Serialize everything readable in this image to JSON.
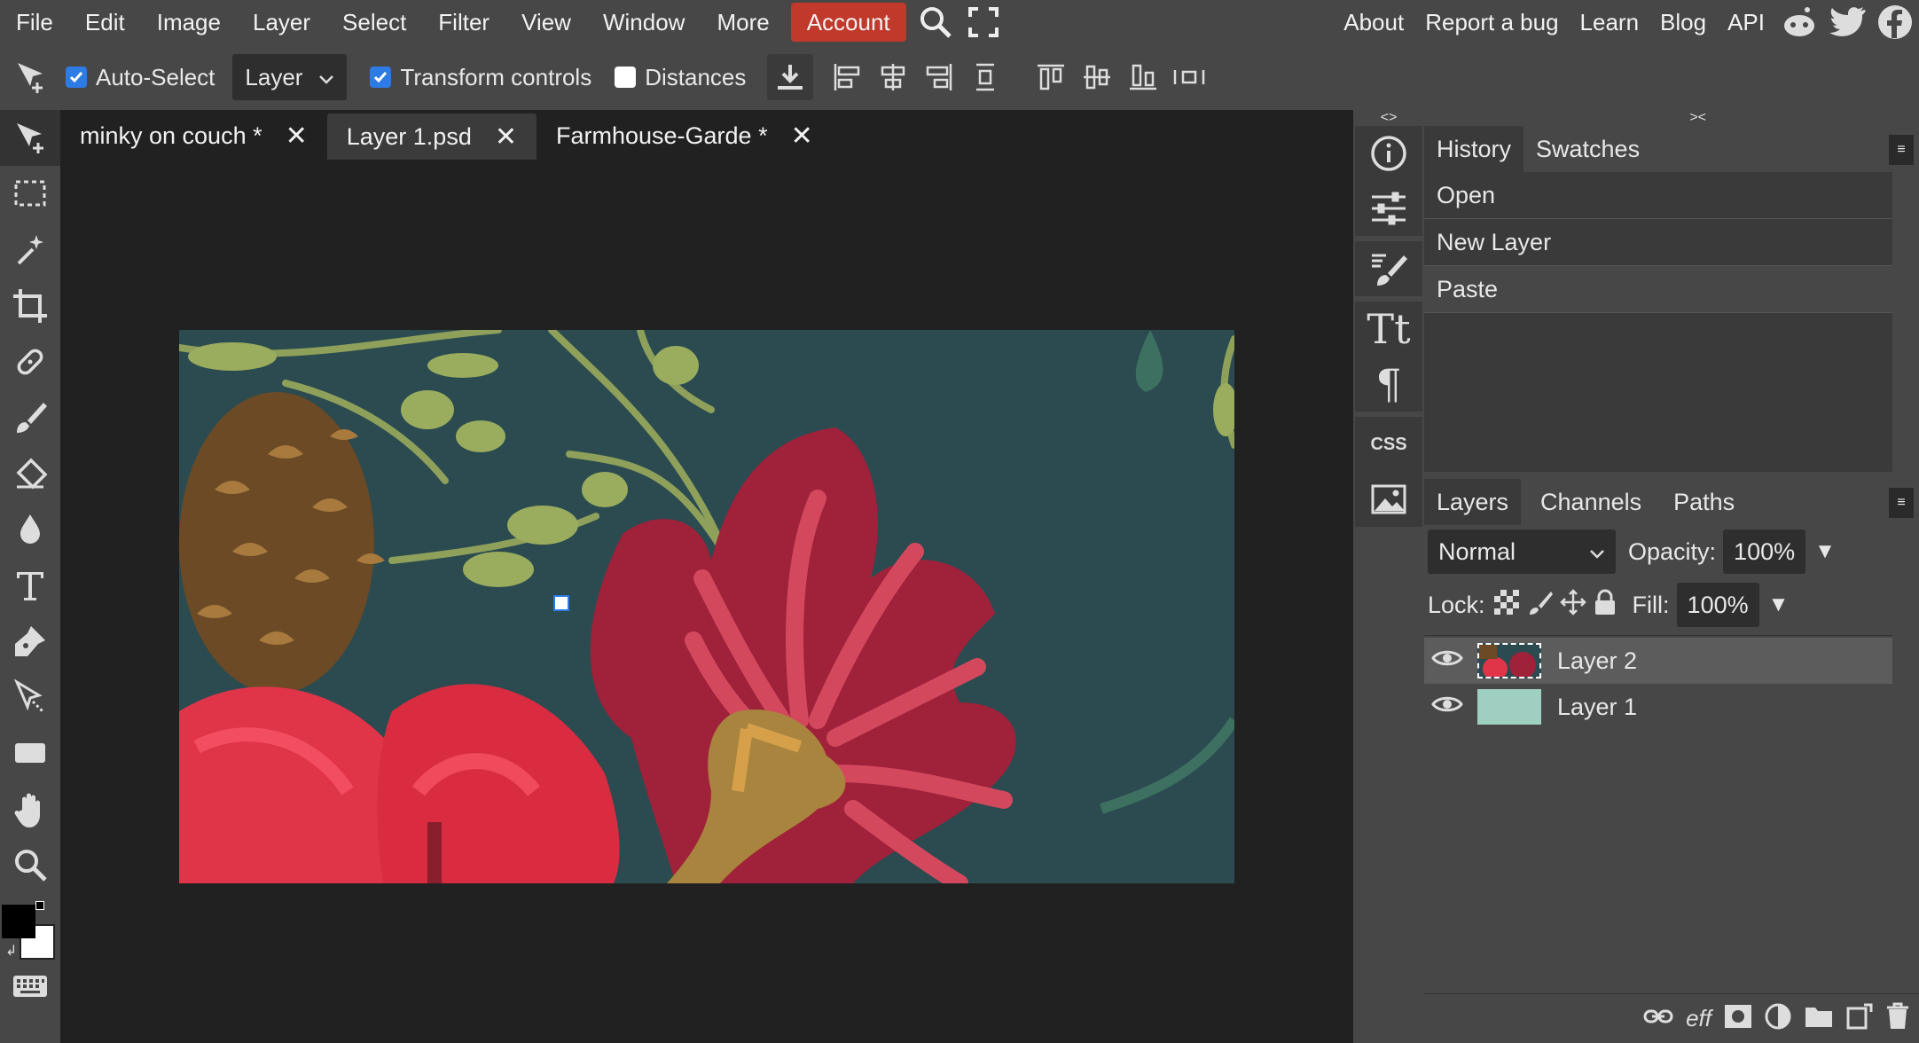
{
  "menubar": {
    "items": [
      "File",
      "Edit",
      "Image",
      "Layer",
      "Select",
      "Filter",
      "View",
      "Window",
      "More",
      "Account"
    ],
    "links": [
      "About",
      "Report a bug",
      "Learn",
      "Blog",
      "API"
    ],
    "icons": [
      "search-icon",
      "fullscreen-icon",
      "reddit-icon",
      "twitter-icon",
      "facebook-icon"
    ]
  },
  "options": {
    "auto_select_label": "Auto-Select",
    "auto_select_checked": true,
    "target_select": "Layer",
    "transform_label": "Transform controls",
    "transform_checked": true,
    "distances_label": "Distances",
    "distances_checked": false
  },
  "tabs": [
    {
      "label": "minky on couch *"
    },
    {
      "label": "Layer 1.psd"
    },
    {
      "label": "Farmhouse-Garde *"
    }
  ],
  "active_tab": 1,
  "history": {
    "tabs": [
      "History",
      "Swatches"
    ],
    "items": [
      "Open",
      "New Layer",
      "Paste"
    ]
  },
  "layers_panel": {
    "tabs": [
      "Layers",
      "Channels",
      "Paths"
    ],
    "blend_mode": "Normal",
    "opacity_label": "Opacity:",
    "opacity_value": "100%",
    "lock_label": "Lock:",
    "fill_label": "Fill:",
    "fill_value": "100%",
    "layers": [
      {
        "name": "Layer 2",
        "visible": true,
        "selected": true
      },
      {
        "name": "Layer 1",
        "visible": true,
        "selected": false
      }
    ],
    "footer_eff_label": "eff"
  },
  "mini_panel": {
    "collapse_left": "<>",
    "collapse_right": "><",
    "css_label": "CSS"
  },
  "colors": {
    "accent": "#c0392b",
    "checkbox": "#2d7be5",
    "artboard_bg": "#2b4b50",
    "layer1_thumb": "#9ecfc0"
  }
}
